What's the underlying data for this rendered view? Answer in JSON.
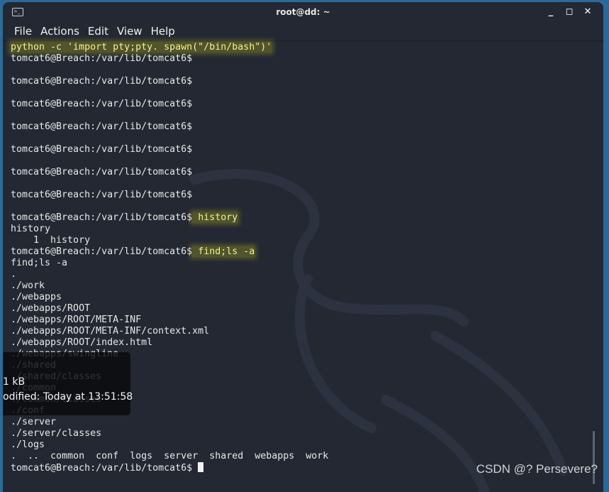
{
  "window": {
    "title": "root@dd: ~",
    "icon": "terminal-icon",
    "controls": [
      "minimize",
      "maximize",
      "close"
    ]
  },
  "menu": [
    "File",
    "Actions",
    "Edit",
    "View",
    "Help"
  ],
  "terminal": {
    "lines": [
      {
        "text": "python -c 'import pty;pty. spawn(\"/bin/bash\")'",
        "highlight": true
      },
      {
        "text": "tomcat6@Breach:/var/lib/tomcat6$"
      },
      {
        "text": ""
      },
      {
        "text": "tomcat6@Breach:/var/lib/tomcat6$"
      },
      {
        "text": ""
      },
      {
        "text": "tomcat6@Breach:/var/lib/tomcat6$"
      },
      {
        "text": ""
      },
      {
        "text": "tomcat6@Breach:/var/lib/tomcat6$"
      },
      {
        "text": ""
      },
      {
        "text": "tomcat6@Breach:/var/lib/tomcat6$"
      },
      {
        "text": ""
      },
      {
        "text": "tomcat6@Breach:/var/lib/tomcat6$"
      },
      {
        "text": ""
      },
      {
        "text": "tomcat6@Breach:/var/lib/tomcat6$"
      },
      {
        "text": ""
      },
      {
        "text": "tomcat6@Breach:/var/lib/tomcat6$",
        "cmd": " history"
      },
      {
        "text": "history"
      },
      {
        "text": "    1  history"
      },
      {
        "text": "tomcat6@Breach:/var/lib/tomcat6$",
        "cmd": " find;ls -a"
      },
      {
        "text": "find;ls -a"
      },
      {
        "text": "."
      },
      {
        "text": "./work"
      },
      {
        "text": "./webapps"
      },
      {
        "text": "./webapps/ROOT"
      },
      {
        "text": "./webapps/ROOT/META-INF"
      },
      {
        "text": "./webapps/ROOT/META-INF/context.xml"
      },
      {
        "text": "./webapps/ROOT/index.html"
      },
      {
        "text": "./webapps/swingline"
      },
      {
        "text": "./shared"
      },
      {
        "text": "./shared/classes"
      },
      {
        "text": "./common"
      },
      {
        "text": "./common/classes"
      },
      {
        "text": "./conf"
      },
      {
        "text": "./server"
      },
      {
        "text": "./server/classes"
      },
      {
        "text": "./logs"
      },
      {
        "text": ".  ..  common  conf  logs  server  shared  webapps  work"
      },
      {
        "text": "tomcat6@Breach:/var/lib/tomcat6$",
        "cursor": true
      }
    ],
    "highlight_color": "#f2f28a"
  },
  "tooltip": {
    "size": "1 kB",
    "modified": "odified: Today at 13:51:58"
  },
  "watermark": "CSDN @? Persevere?"
}
